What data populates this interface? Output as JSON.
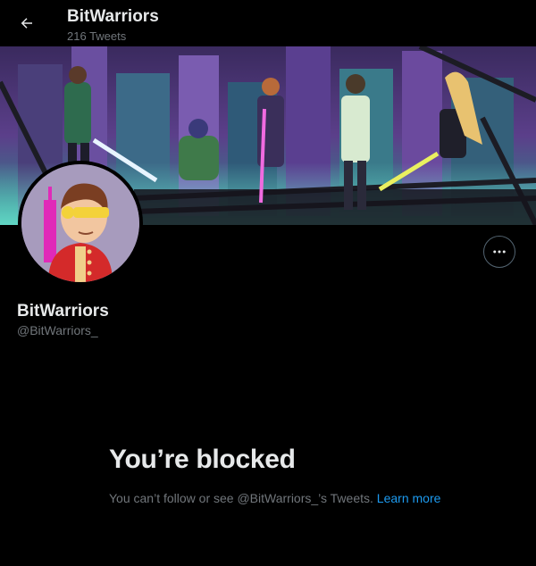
{
  "header": {
    "title": "BitWarriors",
    "tweet_count": "216 Tweets"
  },
  "profile": {
    "name": "BitWarriors",
    "handle": "@BitWarriors_"
  },
  "blocked": {
    "title": "You’re blocked",
    "message": "You can’t follow or see @BitWarriors_’s Tweets.",
    "link_label": "Learn more"
  },
  "icons": {
    "back": "arrow-left-icon",
    "more": "more-horizontal-icon"
  },
  "colors": {
    "background": "#000000",
    "text_primary": "#e7e9ea",
    "text_secondary": "#71767b",
    "link": "#1d9bf0",
    "border": "#536471"
  }
}
